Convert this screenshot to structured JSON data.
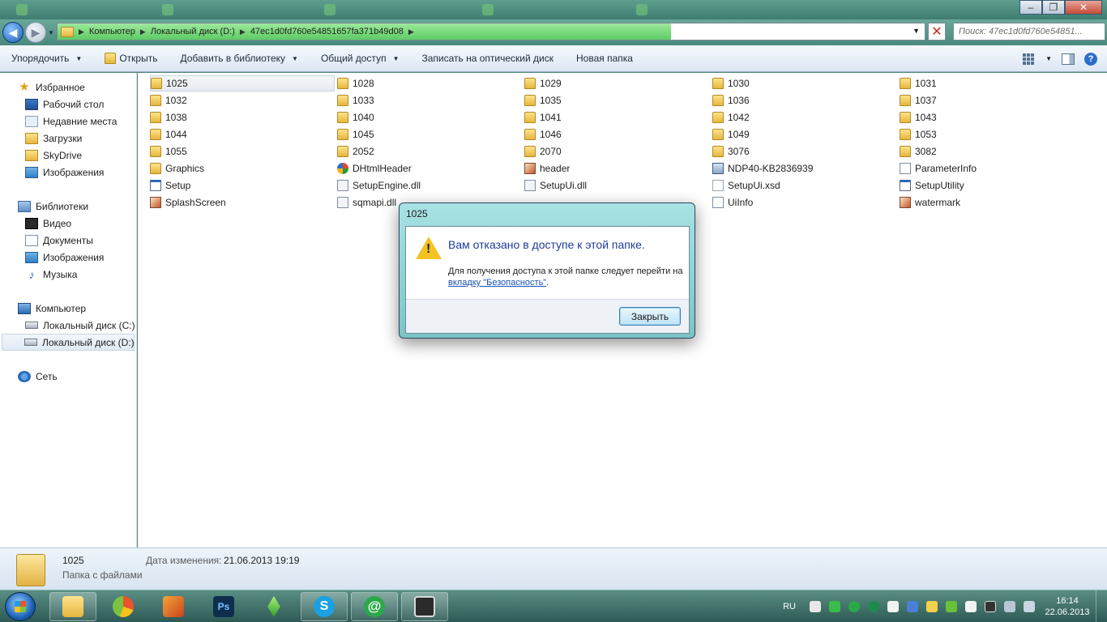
{
  "address": {
    "crumbs": [
      "Компьютер",
      "Локальный диск (D:)",
      "47ec1d0fd760e54851657fa371b49d08"
    ],
    "search_placeholder": "Поиск: 47ec1d0fd760e54851..."
  },
  "toolbar": {
    "organize": "Упорядочить",
    "open": "Открыть",
    "add_library": "Добавить в библиотеку",
    "share": "Общий доступ",
    "burn": "Записать на оптический диск",
    "new_folder": "Новая папка"
  },
  "nav": {
    "favorites": "Избранное",
    "desktop": "Рабочий стол",
    "recent": "Недавние места",
    "downloads": "Загрузки",
    "skydrive": "SkyDrive",
    "pictures_fav": "Изображения",
    "libraries": "Библиотеки",
    "video": "Видео",
    "documents": "Документы",
    "pictures": "Изображения",
    "music": "Музыка",
    "computer": "Компьютер",
    "drive_c": "Локальный диск (C:)",
    "drive_d": "Локальный диск (D:)",
    "network": "Сеть"
  },
  "files": [
    {
      "name": "1025",
      "icon": "folder"
    },
    {
      "name": "1028",
      "icon": "folder"
    },
    {
      "name": "1029",
      "icon": "folder"
    },
    {
      "name": "1030",
      "icon": "folder"
    },
    {
      "name": "1031",
      "icon": "folder"
    },
    {
      "name": "1032",
      "icon": "folder"
    },
    {
      "name": "1033",
      "icon": "folder"
    },
    {
      "name": "1035",
      "icon": "folder"
    },
    {
      "name": "1036",
      "icon": "folder"
    },
    {
      "name": "1037",
      "icon": "folder"
    },
    {
      "name": "1038",
      "icon": "folder"
    },
    {
      "name": "1040",
      "icon": "folder"
    },
    {
      "name": "1041",
      "icon": "folder"
    },
    {
      "name": "1042",
      "icon": "folder"
    },
    {
      "name": "1043",
      "icon": "folder"
    },
    {
      "name": "1044",
      "icon": "folder"
    },
    {
      "name": "1045",
      "icon": "folder"
    },
    {
      "name": "1046",
      "icon": "folder"
    },
    {
      "name": "1049",
      "icon": "folder"
    },
    {
      "name": "1053",
      "icon": "folder"
    },
    {
      "name": "1055",
      "icon": "folder"
    },
    {
      "name": "2052",
      "icon": "folder"
    },
    {
      "name": "2070",
      "icon": "folder"
    },
    {
      "name": "3076",
      "icon": "folder"
    },
    {
      "name": "3082",
      "icon": "folder"
    },
    {
      "name": "Graphics",
      "icon": "folder"
    },
    {
      "name": "DHtmlHeader",
      "icon": "hta"
    },
    {
      "name": "header",
      "icon": "bmp"
    },
    {
      "name": "NDP40-KB2836939",
      "icon": "msu"
    },
    {
      "name": "ParameterInfo",
      "icon": "ini"
    },
    {
      "name": "Setup",
      "icon": "exe"
    },
    {
      "name": "SetupEngine.dll",
      "icon": "dll"
    },
    {
      "name": "SetupUi.dll",
      "icon": "dll"
    },
    {
      "name": "SetupUi.xsd",
      "icon": "xsd"
    },
    {
      "name": "SetupUtility",
      "icon": "exe"
    },
    {
      "name": "SplashScreen",
      "icon": "bmp"
    },
    {
      "name": "sqmapi.dll",
      "icon": "dll"
    },
    {
      "name": "",
      "icon": ""
    },
    {
      "name": "UiInfo",
      "icon": "ini"
    },
    {
      "name": "watermark",
      "icon": "bmp"
    }
  ],
  "details": {
    "name": "1025",
    "type": "Папка с файлами",
    "modified_label": "Дата изменения:",
    "modified_value": "21.06.2013 19:19"
  },
  "dialog": {
    "title": "1025",
    "message": "Вам отказано в доступе к этой папке.",
    "sub_before": "Для получения доступа к этой папке следует перейти на ",
    "link": "вкладку \"Безопасность\"",
    "sub_after": ".",
    "close": "Закрыть"
  },
  "tray": {
    "lang": "RU",
    "time": "16:14",
    "date": "22.06.2013"
  },
  "colors": {
    "accent": "#1d3c9a",
    "selection": "#e6ebf1",
    "address_progress": "#5ccc64"
  }
}
